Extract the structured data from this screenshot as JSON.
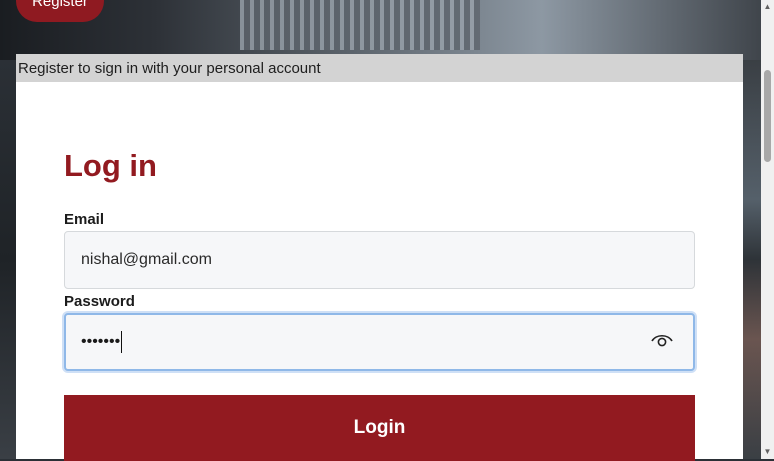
{
  "top_nav": {
    "register_label": "Register"
  },
  "panel": {
    "header_text": "Register to sign in with your personal account",
    "title": "Log in",
    "email": {
      "label": "Email",
      "value": "nishal@gmail.com"
    },
    "password": {
      "label": "Password",
      "masked_value": "•••••••",
      "toggle_icon": "eye-icon"
    },
    "login_label": "Login"
  },
  "colors": {
    "brand": "#921a20",
    "header_bg": "#d3d3d3",
    "focus_ring": "#8fb8e8"
  }
}
